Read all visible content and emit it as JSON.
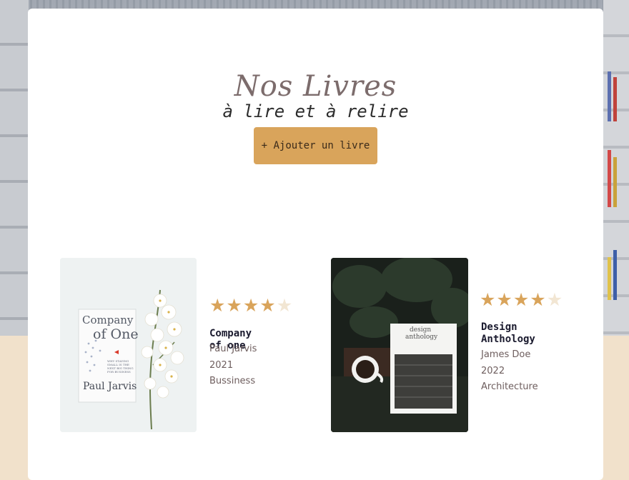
{
  "header": {
    "title": "Nos Livres",
    "subtitle": "à lire et à relire",
    "add_button_label": "+ Ajouter un livre"
  },
  "books": [
    {
      "title": "Company of one",
      "author": "Paul Jarvis",
      "year": "2021",
      "category": "Bussiness",
      "rating": 4,
      "rating_max": 5,
      "cover": {
        "title_line1": "Company",
        "title_line2": "of One",
        "tagline": "WHY STAYING SMALL IS THE NEXT BIG THING FOR BUSINESS",
        "author": "Paul Jarvis"
      }
    },
    {
      "title": "Design Anthology",
      "author": "James Doe",
      "year": "2022",
      "category": "Architecture",
      "rating": 4,
      "rating_max": 5,
      "cover": {
        "title_line1": "design",
        "title_line2": "anthology"
      }
    }
  ],
  "colors": {
    "accent": "#d9a45b",
    "star_empty": "#f2e6d3",
    "title": "#7c6c6c",
    "panel": "#ffffff",
    "page_bottom": "#f1e1cb"
  },
  "icons": {
    "star": "star-icon",
    "plus": "plus-icon"
  }
}
